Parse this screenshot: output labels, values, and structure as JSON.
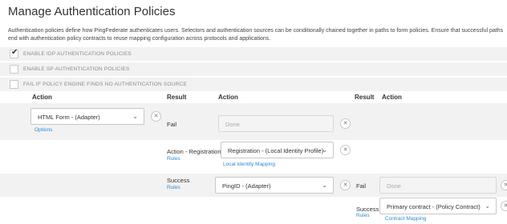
{
  "page": {
    "title": "Manage Authentication Policies",
    "description": "Authentication policies define how PingFederate authenticates users. Selectors and authentication sources can be conditionally chained together in paths to form policies. Ensure that successful paths end with authentication policy contracts to reuse mapping configuration across protocols and applications."
  },
  "options": [
    {
      "label": "ENABLE IDP AUTHENTICATION POLICIES",
      "checked": true
    },
    {
      "label": "ENABLE SP AUTHENTICATION POLICIES",
      "checked": false
    },
    {
      "label": "FAIL IF POLICY ENGINE FINDS NO AUTHENTICATION SOURCE",
      "checked": false
    }
  ],
  "headers": {
    "action": "Action",
    "result": "Result",
    "action2": "Action",
    "result2": "Result",
    "action3": "Action"
  },
  "policy": {
    "root_action": "HTML Form - (Adapter)",
    "options_link": "Options",
    "fail_label": "Fail",
    "fail_value": "Done",
    "registration_label": "Action - Registration",
    "registration_rules": "Rules",
    "registration_action": "Registration - (Local Identity Profile)",
    "local_identity_link": "Local Identity Mapping",
    "success_label": "Success",
    "success_rules": "Rules",
    "success_action": "PingID - (Adapter)",
    "nested_fail_label": "Fail",
    "nested_fail_value": "Done",
    "nested_success_label": "Success",
    "nested_success_rules": "Rules",
    "nested_success_action": "Primary contract - (Policy Contract)",
    "contract_mapping_link": "Contract Mapping"
  },
  "icons": {
    "check": "check-icon",
    "chevron": "chevron-down-icon",
    "remove": "close-icon"
  },
  "colors": {
    "link": "#2d8bd3",
    "band": "#f2f2f2"
  }
}
